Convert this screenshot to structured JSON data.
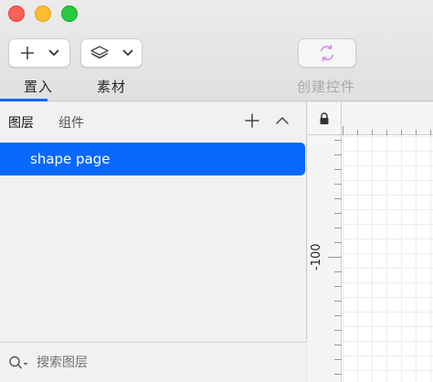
{
  "window": {
    "traffic_lights": [
      "close",
      "minimize",
      "zoom"
    ]
  },
  "toolbar": {
    "insert_label": "置入",
    "assets_label": "素材",
    "create_component_label": "创建控件",
    "insert_icon": "plus-icon",
    "assets_icon": "layers-stack-icon",
    "create_icon": "refresh-cycle-icon",
    "accent_color": "#0a66ff",
    "create_icon_color": "#d08be6"
  },
  "left_panel": {
    "tabs": [
      {
        "label": "图层",
        "active": true
      },
      {
        "label": "组件",
        "active": false
      }
    ],
    "layers": [
      {
        "label": "shape page",
        "selected": true
      }
    ],
    "search": {
      "placeholder": "搜索图层",
      "value": ""
    }
  },
  "canvas": {
    "vertical_ruler_label": "-100"
  }
}
